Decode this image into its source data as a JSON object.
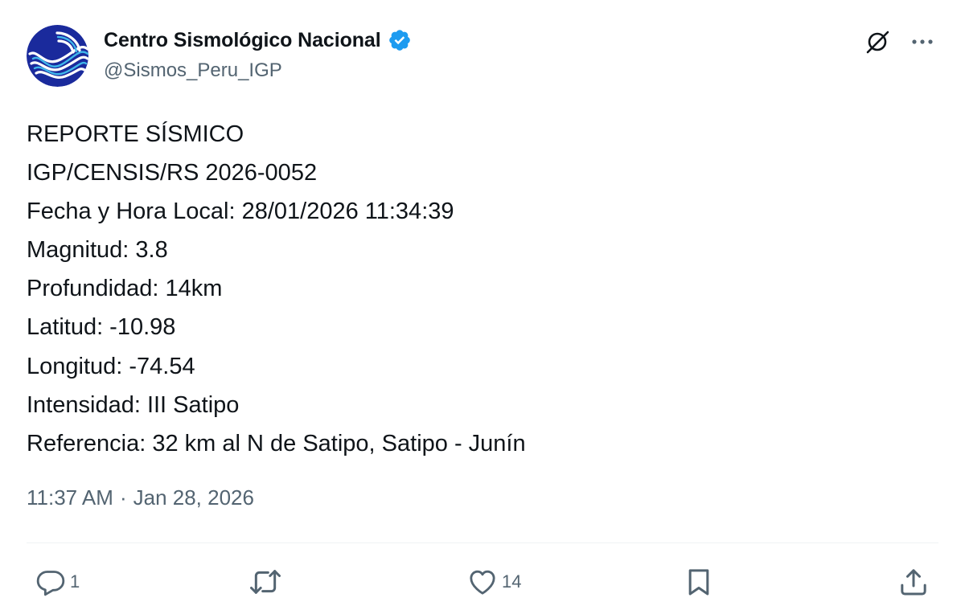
{
  "account": {
    "display_name": "Centro Sismológico Nacional",
    "handle": "@Sismos_Peru_IGP",
    "verified": true
  },
  "tweet": {
    "lines": [
      "REPORTE SÍSMICO",
      "IGP/CENSIS/RS 2026-0052",
      "Fecha y Hora Local: 28/01/2026 11:34:39",
      "Magnitud: 3.8",
      "Profundidad: 14km",
      "Latitud: -10.98",
      "Longitud: -74.54",
      "Intensidad: III Satipo",
      "Referencia: 32 km al N de Satipo, Satipo - Junín"
    ],
    "time": "11:37 AM",
    "separator": "·",
    "date": "Jan 28, 2026"
  },
  "actions": {
    "reply": {
      "icon": "reply-icon",
      "count": "1"
    },
    "repost": {
      "icon": "repost-icon",
      "count": ""
    },
    "like": {
      "icon": "like-icon",
      "count": "14"
    },
    "bookmark": {
      "icon": "bookmark-icon"
    },
    "share": {
      "icon": "share-icon"
    }
  },
  "top_actions": {
    "grok": {
      "icon": "grok-icon"
    },
    "more": {
      "icon": "more-icon"
    }
  },
  "colors": {
    "text": "#0f1419",
    "secondary": "#536471",
    "verified": "#1d9bf0",
    "avatar_bg": "#1a2a9c",
    "divider": "#eff3f4"
  }
}
